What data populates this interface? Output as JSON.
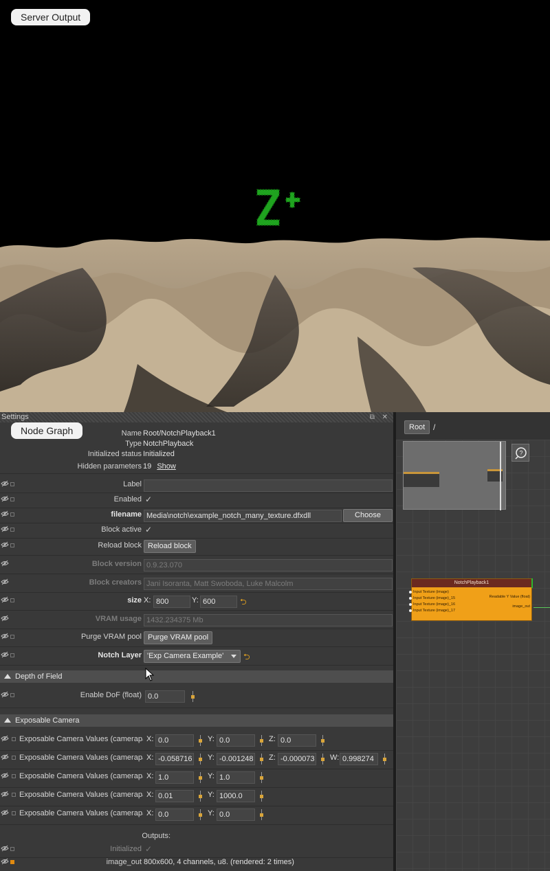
{
  "server_output": {
    "pill_label": "Server Output",
    "logo_text": "Z+",
    "logo_color": "#1fa31f"
  },
  "node_graph_pill": "Node Graph",
  "settings": {
    "title": "Settings",
    "info": [
      {
        "label": "Name",
        "value": "Root/NotchPlayback1"
      },
      {
        "label": "Type",
        "value": "NotchPlayback"
      },
      {
        "label": "Initialized status",
        "value": "Initialized"
      },
      {
        "label": "Hidden parameters",
        "value": "19",
        "link": "Show"
      }
    ],
    "params": {
      "label": {
        "label": "Label",
        "value": ""
      },
      "enabled": {
        "label": "Enabled",
        "checked": "✓"
      },
      "filename": {
        "label": "filename",
        "value": "Media\\notch\\example_notch_many_texture.dfxdll",
        "button": "Choose"
      },
      "block_active": {
        "label": "Block active",
        "checked": "✓"
      },
      "reload_block": {
        "label": "Reload block",
        "button": "Reload block"
      },
      "block_version": {
        "label": "Block version",
        "value": "0.9.23.070"
      },
      "block_creators": {
        "label": "Block creators",
        "value": "Jani Isoranta, Matt Swoboda, Luke Malcolm"
      },
      "size": {
        "label": "size",
        "x_label": "X:",
        "x": "800",
        "y_label": "Y:",
        "y": "600"
      },
      "vram_usage": {
        "label": "VRAM usage",
        "value": "1432.234375 Mb"
      },
      "purge_vram": {
        "label": "Purge VRAM pool",
        "button": "Purge VRAM pool"
      },
      "notch_layer": {
        "label": "Notch Layer",
        "value": "'Exp Camera Example'"
      }
    },
    "dof_section": {
      "title": "Depth of Field",
      "enable_dof": {
        "label": "Enable DoF (float)",
        "value": "0.0"
      }
    },
    "camera_section": {
      "title": "Exposable Camera",
      "rows": [
        {
          "label": "Exposable Camera Values (camerapa",
          "x": "0.0",
          "y": "0.0",
          "z": "0.0"
        },
        {
          "label": "Exposable Camera Values (camerapa",
          "x": "-0.058716",
          "y": "-0.001248",
          "z": "-0.000073",
          "w": "0.998274"
        },
        {
          "label": "Exposable Camera Values (camerapa",
          "x": "1.0",
          "y": "1.0"
        },
        {
          "label": "Exposable Camera Values (camerapa",
          "x": "0.01",
          "y": "1000.0"
        },
        {
          "label": "Exposable Camera Values (camerapa",
          "x": "0.0",
          "y": "0.0"
        }
      ],
      "axis_labels": {
        "x": "X:",
        "y": "Y:",
        "z": "Z:",
        "w": "W:"
      }
    },
    "outputs": {
      "header": "Outputs:",
      "initialized": {
        "label": "Initialized",
        "checked": "✓"
      },
      "image_out": {
        "label": "image_out",
        "value": "800x600, 4 channels, u8. (rendered: 2 times)"
      }
    }
  },
  "node_graph": {
    "root_button": "Root",
    "path_separator": "/",
    "node": {
      "title": "NotchPlayback1",
      "inputs": [
        "Input Texture (image)",
        "Input Texture (image)_15",
        "Input Texture (image)_16",
        "Input Texture (image)_17"
      ],
      "outputs": [
        "Readable Y Value (float)",
        "image_out"
      ],
      "color": "#f0a018"
    }
  }
}
